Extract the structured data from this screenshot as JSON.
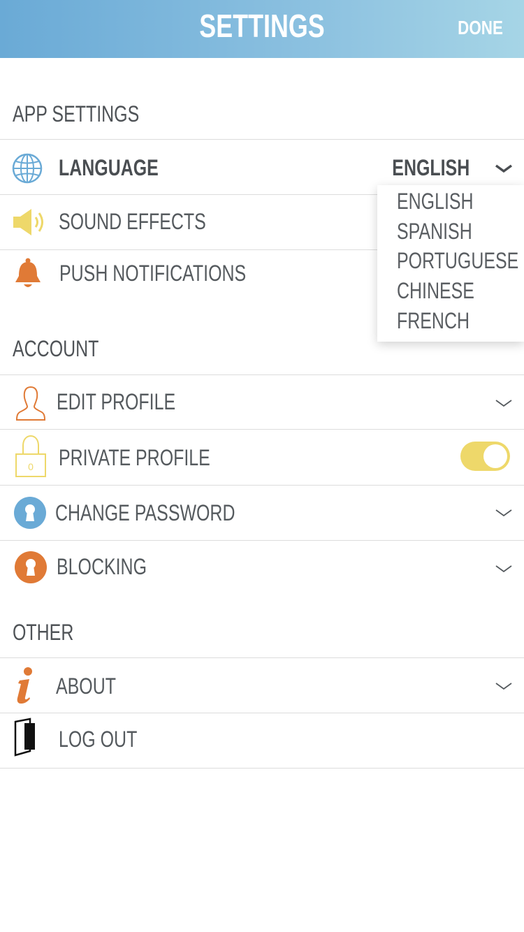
{
  "header": {
    "title": "SETTINGS",
    "done_label": "DONE"
  },
  "sections": {
    "app_settings": "APP SETTINGS",
    "account": "ACCOUNT",
    "other": "OTHER"
  },
  "app_settings": {
    "language": {
      "label": "LANGUAGE",
      "value": "ENGLISH",
      "icon": "globe-icon"
    },
    "sound_effects": {
      "label": "SOUND EFFECTS",
      "icon": "speaker-icon"
    },
    "push_notifications": {
      "label": "PUSH NOTIFICATIONS",
      "icon": "bell-icon"
    }
  },
  "language_dropdown": {
    "options": [
      "ENGLISH",
      "SPANISH",
      "PORTUGUESE",
      "CHINESE",
      "FRENCH"
    ]
  },
  "account": {
    "edit_profile": {
      "label": "EDIT PROFILE",
      "icon": "person-icon"
    },
    "private_profile": {
      "label": "PRIVATE PROFILE",
      "icon": "lock-icon",
      "enabled": true
    },
    "change_password": {
      "label": "CHANGE PASSWORD",
      "icon": "keyhole-icon"
    },
    "blocking": {
      "label": "BLOCKING",
      "icon": "keyhole-icon"
    }
  },
  "other": {
    "about": {
      "label": "ABOUT",
      "icon": "info-icon"
    },
    "log_out": {
      "label": "LOG OUT",
      "icon": "door-icon"
    }
  },
  "colors": {
    "header_start": "#6aaad6",
    "header_end": "#a6d5e6",
    "blue_accent": "#6aaad6",
    "orange_accent": "#e07a36",
    "yellow_accent": "#eed86a"
  }
}
